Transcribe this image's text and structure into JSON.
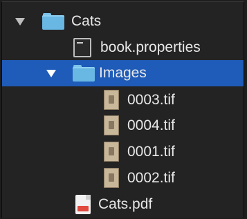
{
  "tree": {
    "root_folder": {
      "label": "Cats",
      "icon": "folder-icon",
      "expanded": true
    },
    "book_properties": {
      "label": "book.properties",
      "icon": "properties-file-icon"
    },
    "images_folder": {
      "label": "Images",
      "icon": "folder-icon",
      "expanded": true,
      "selected": true
    },
    "images": [
      {
        "label": "0003.tif",
        "icon": "tif-thumbnail-icon"
      },
      {
        "label": "0004.tif",
        "icon": "tif-thumbnail-icon"
      },
      {
        "label": "0001.tif",
        "icon": "tif-thumbnail-icon"
      },
      {
        "label": "0002.tif",
        "icon": "tif-thumbnail-icon"
      }
    ],
    "cats_pdf": {
      "label": "Cats.pdf",
      "icon": "pdf-file-icon"
    }
  },
  "colors": {
    "background": "#232323",
    "selection": "#1f5bb8",
    "folder": "#69b7e3",
    "text": "#e8e8e8"
  }
}
